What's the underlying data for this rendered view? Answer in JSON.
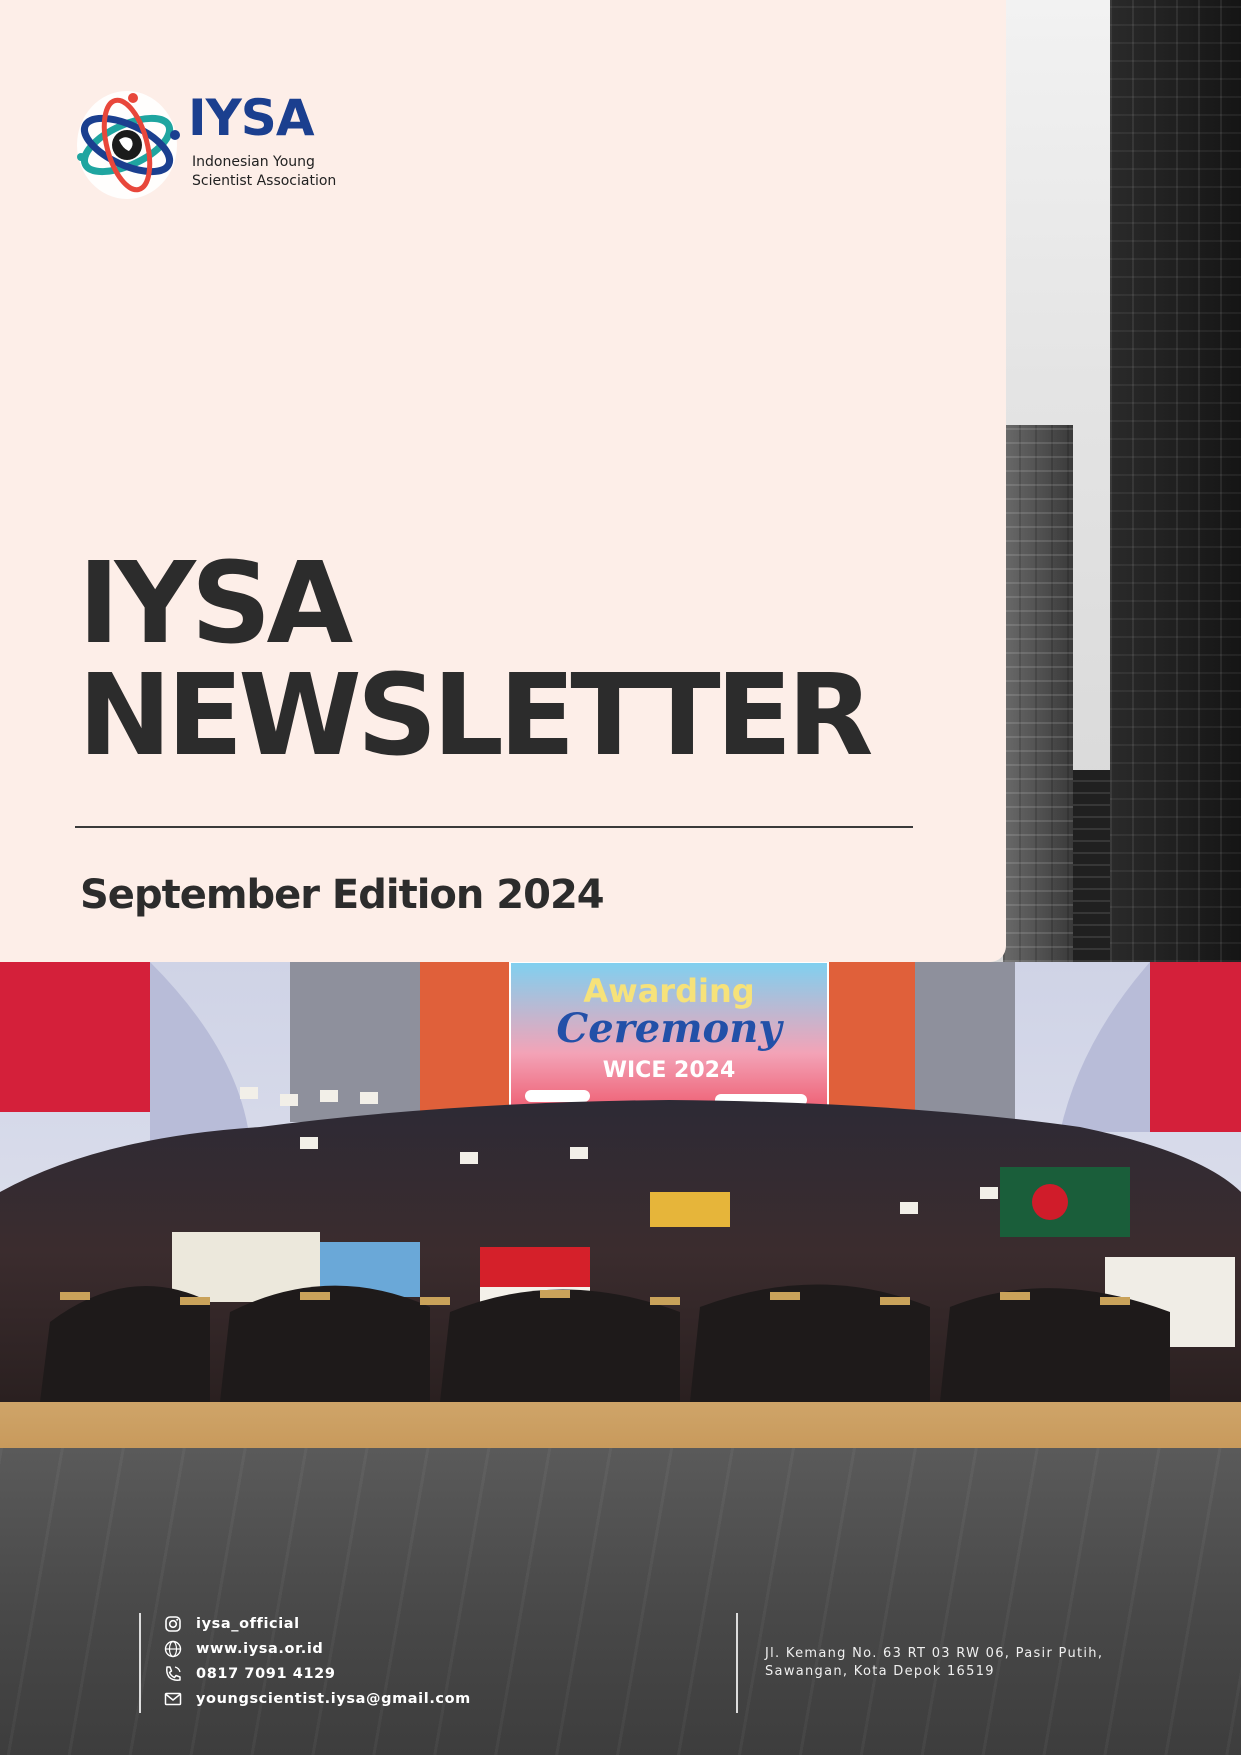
{
  "brand": {
    "logo_text": "IYSA",
    "logo_subtitle": "Indonesian Young Scientist Association",
    "colors": {
      "blue": "#1b3f8f",
      "teal": "#1fa5a0",
      "red": "#e8473b",
      "card": "#fdeee8",
      "ink": "#2c2c2c"
    }
  },
  "cover": {
    "title_line1": "IYSA",
    "title_line2": "NEWSLETTER",
    "edition": "September Edition 2024"
  },
  "photo": {
    "screen_title": "Awarding",
    "screen_subtitle": "Ceremony",
    "screen_event": "WICE 2024",
    "icon": "group-photo"
  },
  "contact": {
    "instagram": "iysa_official",
    "website": "www.iysa.or.id",
    "phone": "0817 7091 4129",
    "email": "youngscientist.iysa@gmail.com",
    "address_line1": "Jl. Kemang No. 63 RT 03 RW 06, Pasir Putih,",
    "address_line2": "Sawangan, Kota Depok 16519"
  }
}
